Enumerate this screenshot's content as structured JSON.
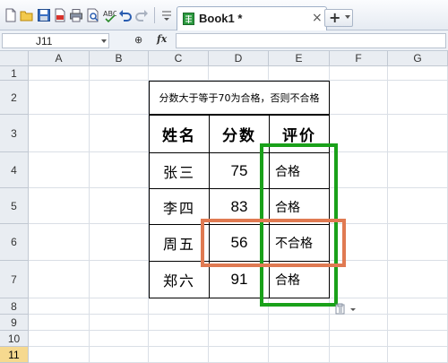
{
  "toolbar": {
    "icons": [
      "new-file-icon",
      "open-folder-icon",
      "save-icon",
      "export-pdf-icon",
      "print-icon",
      "print-preview-icon",
      "spellcheck-icon",
      "undo-icon",
      "redo-icon",
      "customize-icon"
    ],
    "tab_label": "Book1 *",
    "tab_close": "×",
    "new_tab": "+"
  },
  "formula_bar": {
    "name_box": "J11",
    "zoom_symbol": "⊕",
    "fx_label": "fx",
    "formula": ""
  },
  "grid": {
    "columns": [
      "A",
      "B",
      "C",
      "D",
      "E",
      "F",
      "G"
    ],
    "rows": [
      "1",
      "2",
      "3",
      "4",
      "5",
      "6",
      "7",
      "8",
      "9",
      "10",
      "11"
    ],
    "active_row": "11"
  },
  "table": {
    "title": "分数大于等于70为合格，否则不合格",
    "headers": [
      "姓名",
      "分数",
      "评价"
    ],
    "rows": [
      {
        "name": "张三",
        "score": "75",
        "eval": "合格"
      },
      {
        "name": "李四",
        "score": "83",
        "eval": "合格"
      },
      {
        "name": "周五",
        "score": "56",
        "eval": "不合格"
      },
      {
        "name": "郑六",
        "score": "91",
        "eval": "合格"
      }
    ]
  },
  "colors": {
    "green_highlight": "#1aa11a",
    "orange_highlight": "#e07a52",
    "active_row_header": "#f6d98f"
  }
}
